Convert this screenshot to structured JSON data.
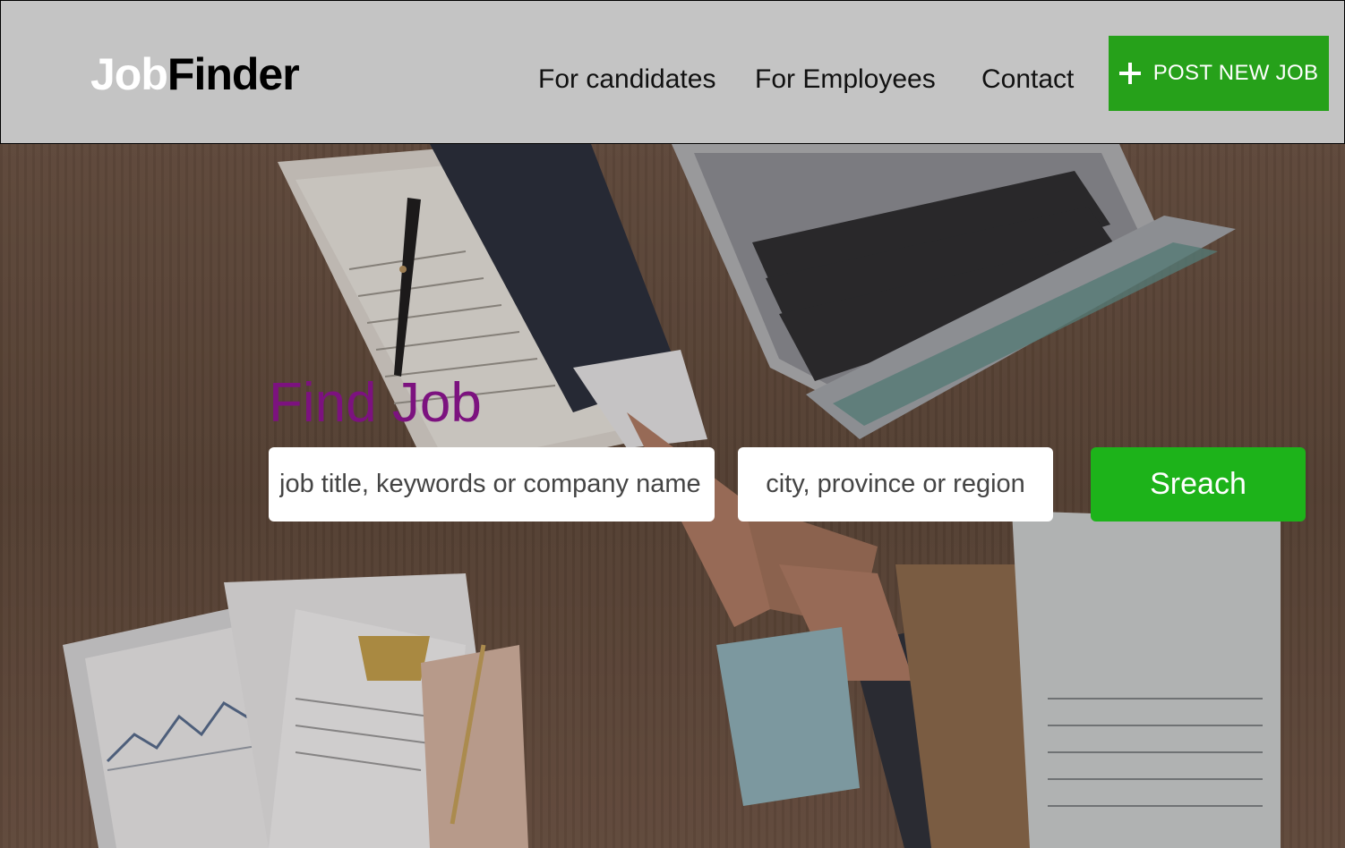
{
  "header": {
    "logo_part1": "Job",
    "logo_part2": "Finder",
    "nav": [
      {
        "label": "For candidates"
      },
      {
        "label": "For Employees"
      },
      {
        "label": "Contact"
      }
    ],
    "post_button": {
      "label": "POST NEW JOB",
      "icon": "plus-icon",
      "color": "#26a11a"
    }
  },
  "hero": {
    "title": "Find Job",
    "title_color": "#7c127f",
    "keyword_input": {
      "placeholder": "job title, keywords or company name",
      "value": ""
    },
    "location_input": {
      "placeholder": "city, province or region",
      "value": ""
    },
    "search_button": {
      "label": "Sreach",
      "color": "#1db31a"
    }
  }
}
